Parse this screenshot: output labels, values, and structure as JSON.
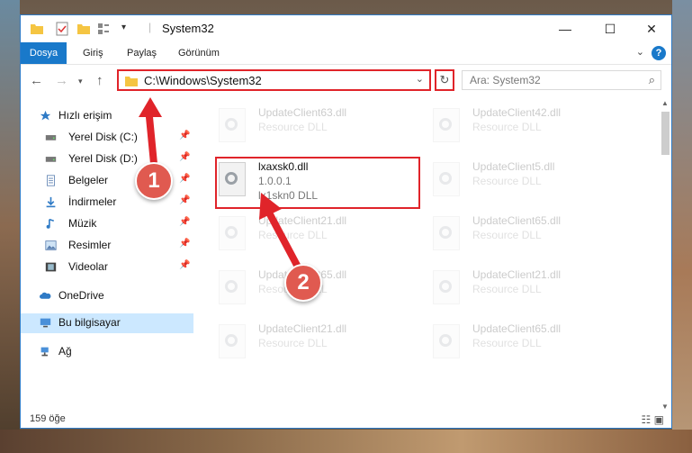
{
  "window": {
    "title": "System32"
  },
  "ribbon": {
    "tabs": [
      "Dosya",
      "Giriş",
      "Paylaş",
      "Görünüm"
    ],
    "help": "?"
  },
  "nav_bar": {
    "address": "C:\\Windows\\System32",
    "search_placeholder": "Ara: System32"
  },
  "sidebar": {
    "items": [
      {
        "label": "Hızlı erişim",
        "icon": "star-icon"
      },
      {
        "label": "Yerel Disk (C:)",
        "icon": "drive-icon",
        "pinned": true
      },
      {
        "label": "Yerel Disk (D:)",
        "icon": "drive-icon",
        "pinned": true
      },
      {
        "label": "Belgeler",
        "icon": "documents-icon",
        "pinned": true
      },
      {
        "label": "İndirmeler",
        "icon": "download-icon",
        "pinned": true
      },
      {
        "label": "Müzik",
        "icon": "music-icon",
        "pinned": true
      },
      {
        "label": "Resimler",
        "icon": "pictures-icon",
        "pinned": true
      },
      {
        "label": "Videolar",
        "icon": "videos-icon",
        "pinned": true
      },
      {
        "label": "OneDrive",
        "icon": "cloud-icon"
      },
      {
        "label": "Bu bilgisayar",
        "icon": "computer-icon",
        "selected": true
      },
      {
        "label": "Ağ",
        "icon": "network-icon"
      }
    ]
  },
  "files": [
    {
      "name": "UpdateClient63.dll",
      "type": "Resource DLL",
      "faded": true
    },
    {
      "name": "UpdateClient42.dll",
      "type": "Resource DLL",
      "faded": true
    },
    {
      "name": "lxaxsk0.dll",
      "version": "1.0.0.1",
      "type": "lx1skn0 DLL",
      "faded": false,
      "highlighted": true
    },
    {
      "name": "UpdateClient5.dll",
      "type": "Resource DLL",
      "faded": true
    },
    {
      "name": "UpdateClient21.dll",
      "type": "Resource DLL",
      "faded": true
    },
    {
      "name": "UpdateClient65.dll",
      "type": "Resource DLL",
      "faded": true
    },
    {
      "name": "UpdateClient65.dll",
      "type": "Resource DLL",
      "faded": true
    },
    {
      "name": "UpdateClient21.dll",
      "type": "Resource DLL",
      "faded": true
    },
    {
      "name": "UpdateClient21.dll",
      "type": "Resource DLL",
      "faded": true
    },
    {
      "name": "UpdateClient65.dll",
      "type": "Resource DLL",
      "faded": true
    }
  ],
  "status": {
    "count": "159 öğe"
  },
  "annotations": {
    "step1": "1",
    "step2": "2",
    "color": "#e0242a"
  }
}
